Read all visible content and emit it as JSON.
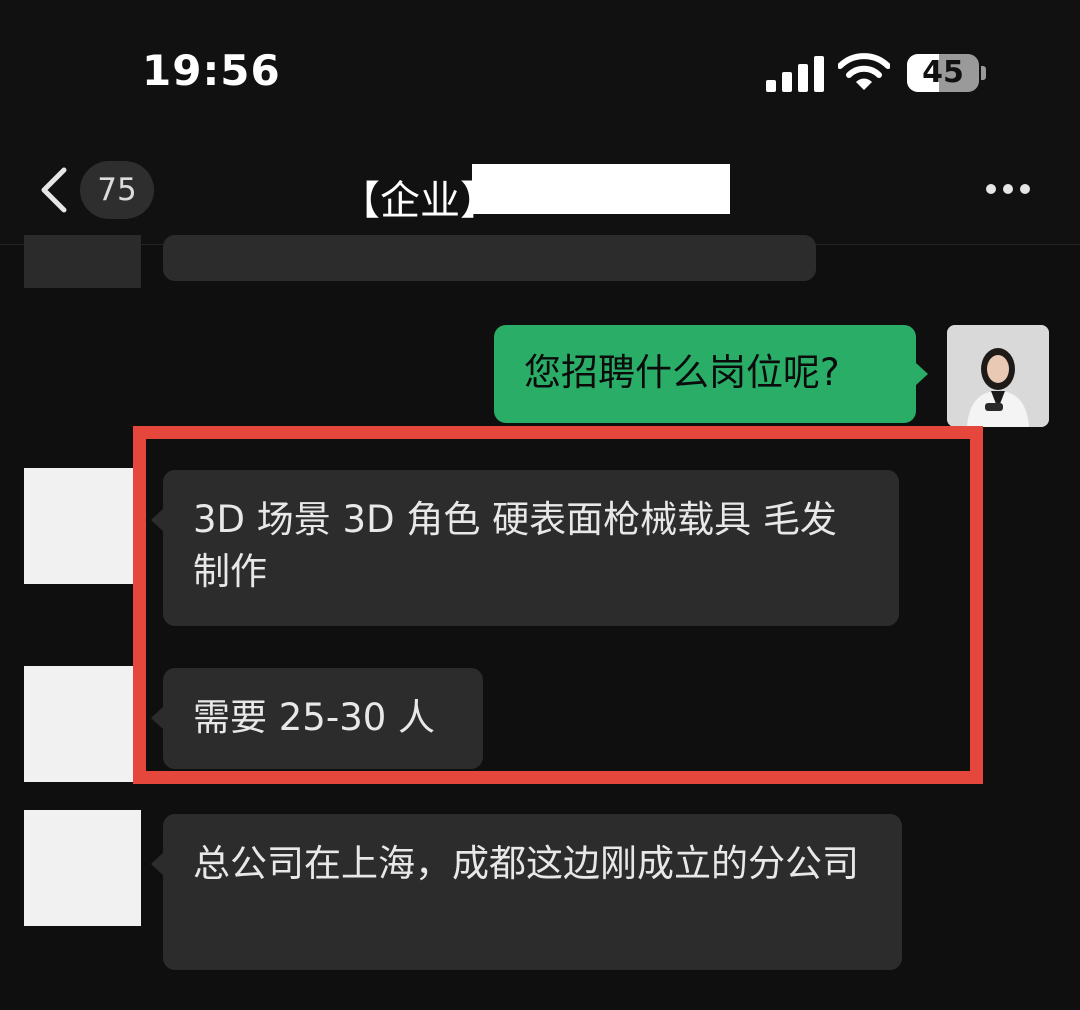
{
  "status_bar": {
    "time": "19:56",
    "battery_percent": "45",
    "battery_level": 0.45
  },
  "nav": {
    "unread_count": "75",
    "title": "【企业】"
  },
  "messages": [
    {
      "side": "right",
      "text": "您招聘什么岗位呢?"
    },
    {
      "side": "left",
      "text": "3D 场景 3D 角色 硬表面枪械载具  毛发制作"
    },
    {
      "side": "left",
      "text": "需要 25-30 人"
    },
    {
      "side": "left",
      "text": "总公司在上海，成都这边刚成立的分公司"
    }
  ],
  "colors": {
    "background": "#0f0f0f",
    "bubble_incoming": "#2c2c2c",
    "bubble_outgoing": "#2aae67",
    "highlight": "#e5473d"
  }
}
